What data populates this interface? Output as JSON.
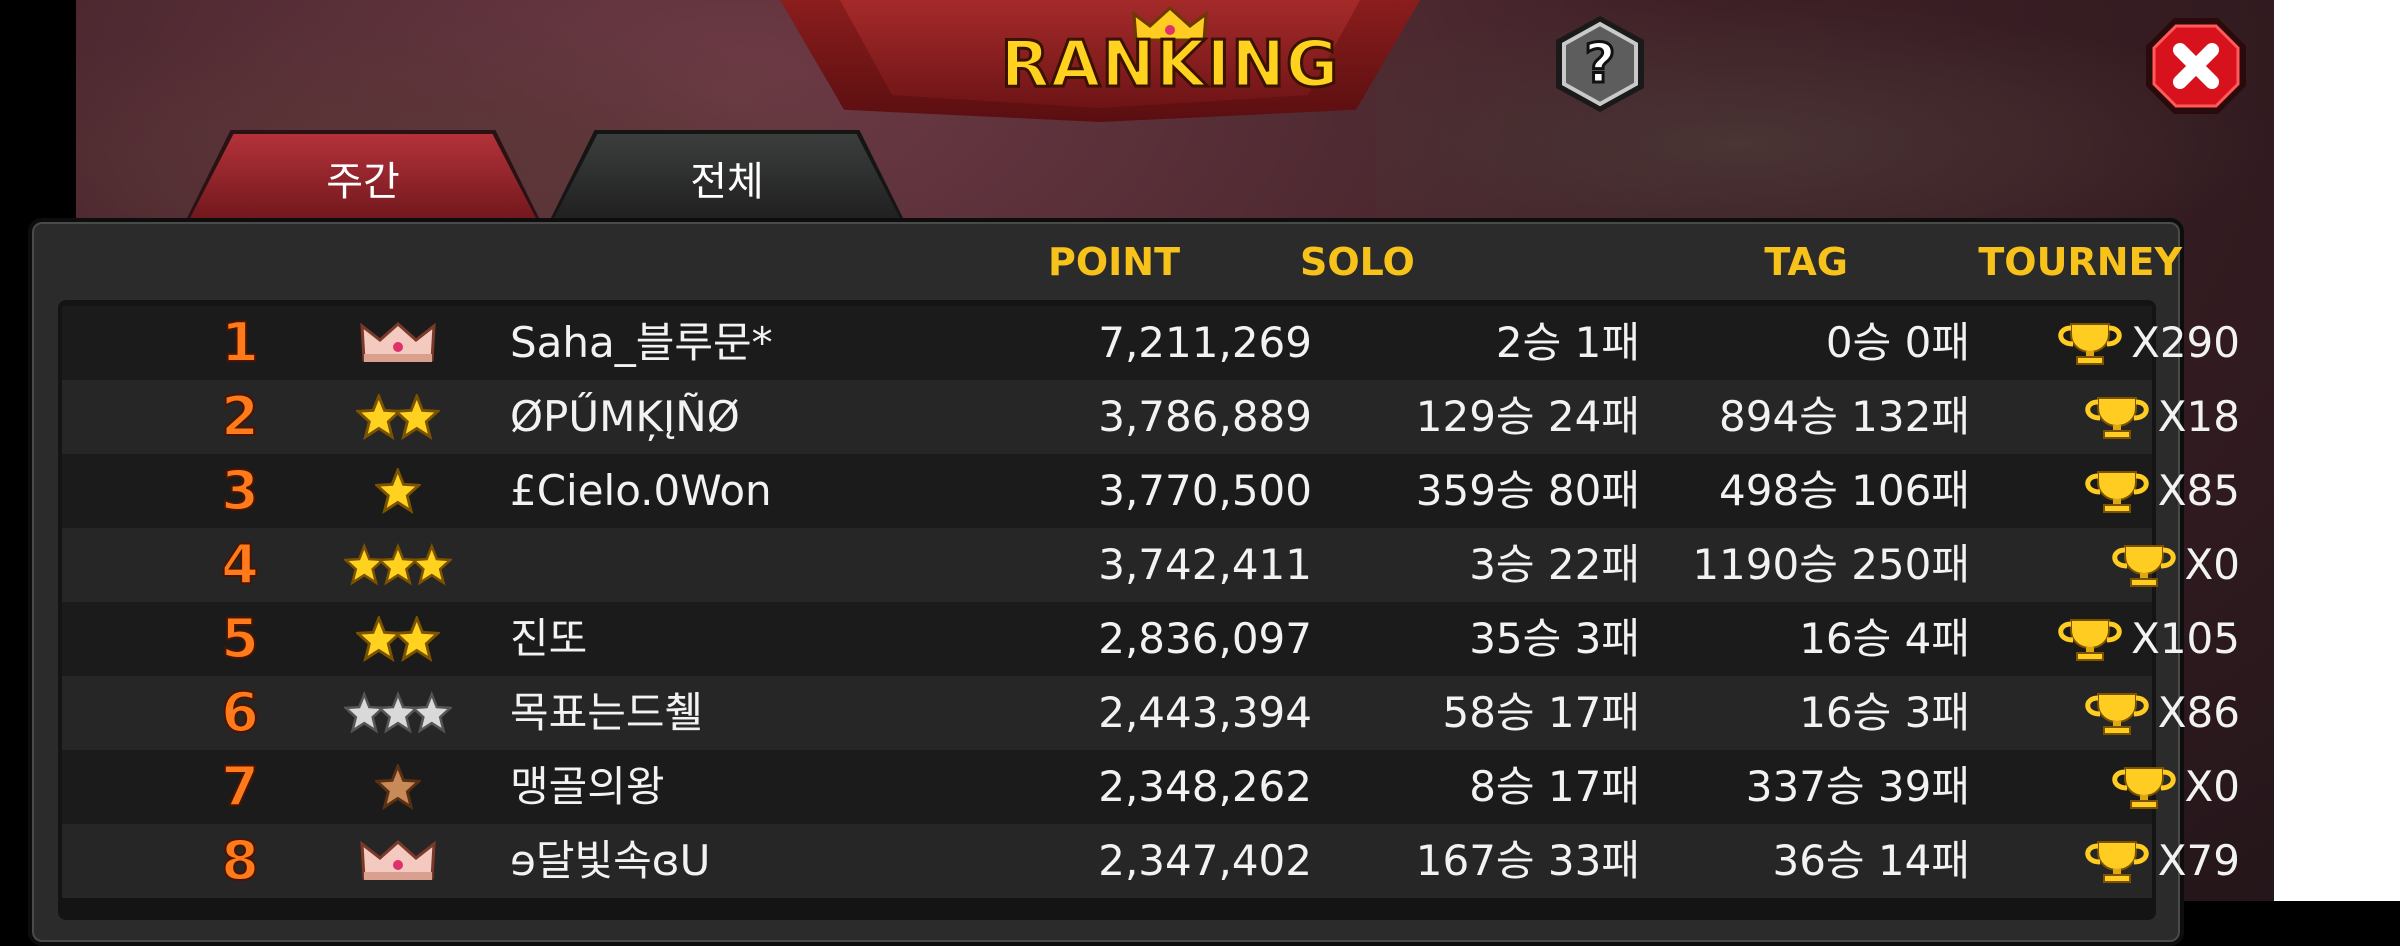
{
  "title": "RANKING",
  "tabs": [
    {
      "label": "주간",
      "active": true
    },
    {
      "label": "전체",
      "active": false
    }
  ],
  "columns": {
    "point": "POINT",
    "solo": "SOLO",
    "tag": "TAG",
    "tourney": "TOURNEY"
  },
  "rows": [
    {
      "rank": "1",
      "badge": "crown",
      "name": "Saha_블루문*",
      "point": "7,211,269",
      "solo": "2승 1패",
      "tag": "0승 0패",
      "tourney": "X290"
    },
    {
      "rank": "2",
      "badge": "gold-stars-2",
      "name": "ØPŰMĶĮÑØ",
      "point": "3,786,889",
      "solo": "129승 24패",
      "tag": "894승 132패",
      "tourney": "X18"
    },
    {
      "rank": "3",
      "badge": "gold-star-1",
      "name": "£Cielo.0Won",
      "point": "3,770,500",
      "solo": "359승 80패",
      "tag": "498승 106패",
      "tourney": "X85"
    },
    {
      "rank": "4",
      "badge": "gold-stars-3",
      "name": "",
      "point": "3,742,411",
      "solo": "3승 22패",
      "tag": "1190승 250패",
      "tourney": "X0"
    },
    {
      "rank": "5",
      "badge": "gold-stars-2",
      "name": "진또",
      "point": "2,836,097",
      "solo": "35승 3패",
      "tag": "16승 4패",
      "tourney": "X105"
    },
    {
      "rank": "6",
      "badge": "silver-stars-3",
      "name": "목표는드췔",
      "point": "2,443,394",
      "solo": "58승 17패",
      "tag": "16승 3패",
      "tourney": "X86"
    },
    {
      "rank": "7",
      "badge": "bronze-star-1",
      "name": "맹골의왕",
      "point": "2,348,262",
      "solo": "8승 17패",
      "tag": "337승 39패",
      "tourney": "X0"
    },
    {
      "rank": "8",
      "badge": "crown",
      "name": "ɘ달빛속ɞU",
      "point": "2,347,402",
      "solo": "167승 33패",
      "tag": "36승 14패",
      "tourney": "X79"
    }
  ],
  "colors": {
    "accent": "#f7c21a",
    "rank": "#ff7a1a",
    "close": "#d8121c"
  },
  "icons": {
    "help": "question-icon",
    "close": "close-icon",
    "tourney": "trophy-icon"
  }
}
